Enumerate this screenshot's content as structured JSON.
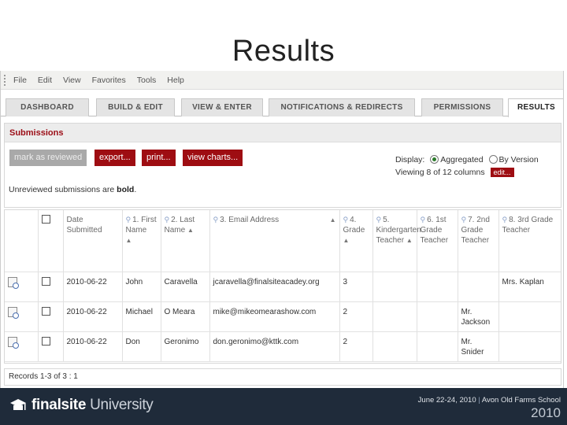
{
  "slide": {
    "title": "Results"
  },
  "menubar": {
    "items": [
      "File",
      "Edit",
      "View",
      "Favorites",
      "Tools",
      "Help"
    ]
  },
  "tabs": [
    {
      "label": "DASHBOARD",
      "active": false
    },
    {
      "label": "BUILD & EDIT",
      "active": false
    },
    {
      "label": "VIEW & ENTER",
      "active": false
    },
    {
      "label": "NOTIFICATIONS & REDIRECTS",
      "active": false
    },
    {
      "label": "PERMISSIONS",
      "active": false
    },
    {
      "label": "RESULTS",
      "active": true
    }
  ],
  "submissions": {
    "header": "Submissions",
    "buttons": {
      "mark_reviewed": "mark as reviewed",
      "export": "export...",
      "print": "print...",
      "view_charts": "view charts..."
    },
    "display_label": "Display:",
    "display_options": [
      "Aggregated",
      "By Version"
    ],
    "display_selected": "Aggregated",
    "viewing_text": "Viewing 8 of 12 columns",
    "edit_label": "edit...",
    "unreviewed_prefix": "Unreviewed submissions are ",
    "unreviewed_bold": "bold",
    "unreviewed_suffix": "."
  },
  "table": {
    "columns": [
      "Date Submitted",
      "1. First Name",
      "2. Last Name",
      "3. Email Address",
      "4. Grade",
      "5. Kindergarten Teacher",
      "6. 1st Grade Teacher",
      "7. 2nd Grade Teacher",
      "8. 3rd Grade Teacher"
    ],
    "rows": [
      {
        "date": "2010-06-22",
        "first": "John",
        "last": "Caravella",
        "email": "jcaravella@finalsiteacadey.org",
        "grade": "3",
        "k": "",
        "g1": "",
        "g2": "",
        "g3": "Mrs. Kaplan"
      },
      {
        "date": "2010-06-22",
        "first": "Michael",
        "last": "O Meara",
        "email": "mike@mikeomearashow.com",
        "grade": "2",
        "k": "",
        "g1": "",
        "g2": "Mr. Jackson",
        "g3": ""
      },
      {
        "date": "2010-06-22",
        "first": "Don",
        "last": "Geronimo",
        "email": "don.geronimo@kttk.com",
        "grade": "2",
        "k": "",
        "g1": "",
        "g2": "Mr. Snider",
        "g3": ""
      }
    ]
  },
  "records": {
    "text": "Records 1-3 of 3 : 1"
  },
  "footer": {
    "brand": "finalsite",
    "brand_suffix": "University",
    "event_date": "June 22-24, 2010",
    "event_sep": "|",
    "event_place": "Avon Old Farms School",
    "event_year": "2010"
  },
  "colors": {
    "accent": "#9e0d12",
    "footer_bg": "#1f2b3a"
  }
}
